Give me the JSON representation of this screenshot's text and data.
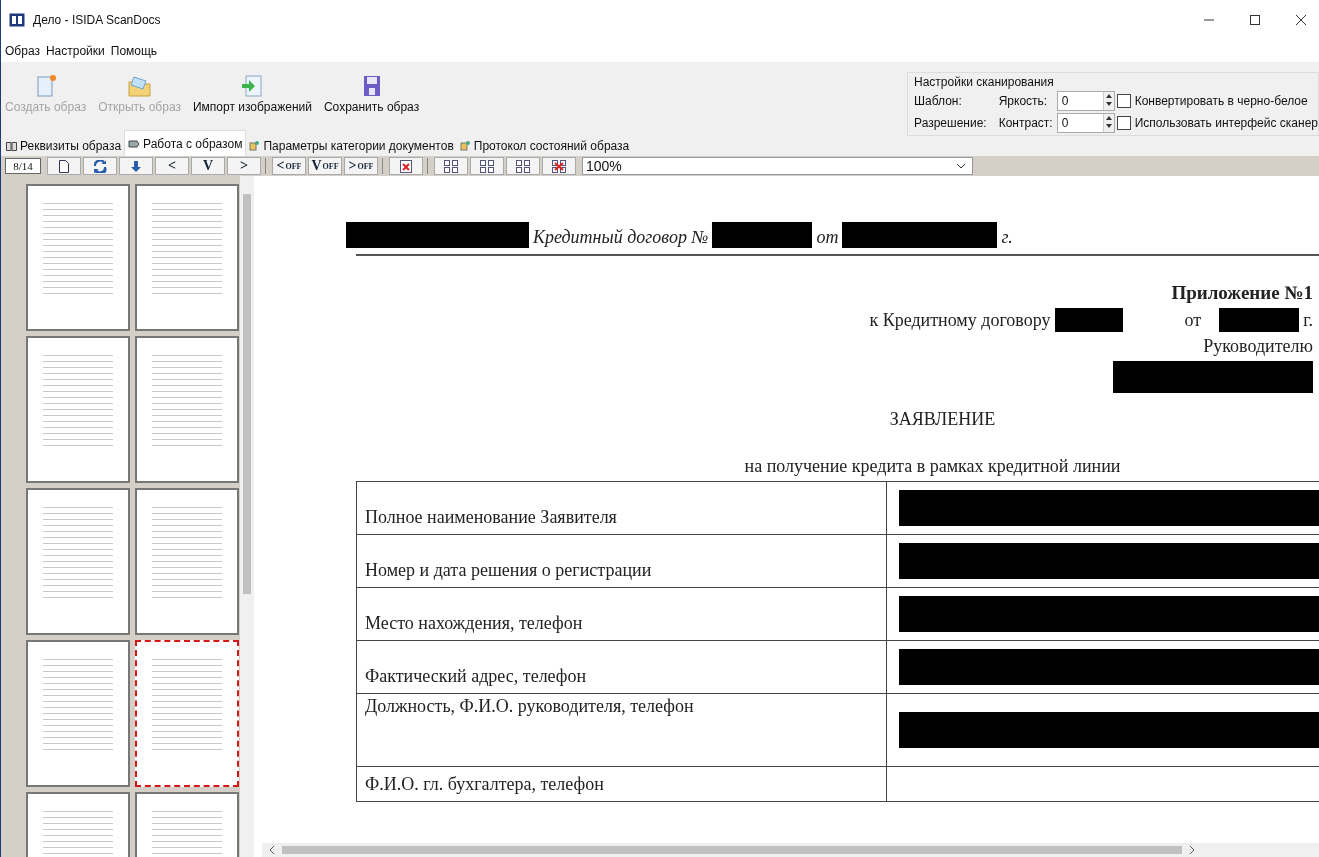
{
  "window": {
    "title": "Дело - ISIDA ScanDocs"
  },
  "menu": [
    "Образ",
    "Настройки",
    "Помощь"
  ],
  "ribbon_buttons": [
    {
      "kind": "new",
      "label": "Создать образ",
      "disabled": true
    },
    {
      "kind": "open",
      "label": "Открыть образ",
      "disabled": true
    },
    {
      "kind": "import",
      "label": "Импорт изображений",
      "disabled": false
    },
    {
      "kind": "save",
      "label": "Сохранить образ",
      "disabled": false
    }
  ],
  "scan_settings": {
    "title": "Настройки сканирования",
    "template_label": "Шаблон:",
    "resolution_label": "Разрешение:",
    "brightness_label": "Яркость:",
    "brightness": "0",
    "contrast_label": "Контраст:",
    "contrast": "0",
    "checkboxes": [
      {
        "label": "Конвертировать в черно-белое",
        "checked": false
      },
      {
        "label": "Использовать интерфейс сканер",
        "checked": false
      }
    ]
  },
  "tabs": [
    {
      "kind": "book",
      "label": "Реквизиты образа",
      "selected": false
    },
    {
      "kind": "work",
      "label": "Работа с образом",
      "selected": true
    },
    {
      "kind": "params",
      "label": "Параметры категории документов",
      "selected": false
    },
    {
      "kind": "params",
      "label": "Протокол состояний образа",
      "selected": false
    }
  ],
  "toolbar": {
    "page_counter": "8/14",
    "zoom": "100%",
    "buttons": [
      {
        "kind": "page"
      },
      {
        "kind": "rotate"
      },
      {
        "kind": "down"
      },
      {
        "kind": "text",
        "label": "<"
      },
      {
        "kind": "text",
        "label": "V"
      },
      {
        "kind": "text",
        "label": ">"
      },
      {
        "kind": "separator"
      },
      {
        "kind": "off",
        "label": "<",
        "sub": "OFF"
      },
      {
        "kind": "off",
        "label": "V",
        "sub": "OFF"
      },
      {
        "kind": "off",
        "label": ">",
        "sub": "OFF"
      },
      {
        "kind": "separator"
      },
      {
        "kind": "delete"
      },
      {
        "kind": "separator"
      },
      {
        "kind": "grid"
      },
      {
        "kind": "grid"
      },
      {
        "kind": "grid"
      },
      {
        "kind": "grid-delete"
      }
    ]
  },
  "thumbnails": [
    {
      "selected": false
    },
    {
      "selected": false
    },
    {
      "selected": false
    },
    {
      "selected": false
    },
    {
      "selected": false
    },
    {
      "selected": false
    },
    {
      "selected": false
    },
    {
      "selected": true
    },
    {
      "selected": false
    },
    {
      "selected": false
    }
  ],
  "document": {
    "header_title": "Кредитный договор №",
    "header_from": "от",
    "header_year": "г.",
    "appendix": "Приложение №1",
    "to_contract": "к Кредитному договору",
    "from": "от",
    "year": "г.",
    "addressee": "Руководителю",
    "heading": "ЗАЯВЛЕНИЕ",
    "subheading": "на получение кредита в рамках кредитной линии",
    "rows": [
      "Полное наименование Заявителя",
      "Номер и дата решения о регистрации",
      "Место нахождения, телефон",
      "Фактический адрес, телефон",
      "Должность, Ф.И.О. руководителя, телефон",
      "Ф.И.О. гл. бухгалтера, телефон"
    ]
  }
}
